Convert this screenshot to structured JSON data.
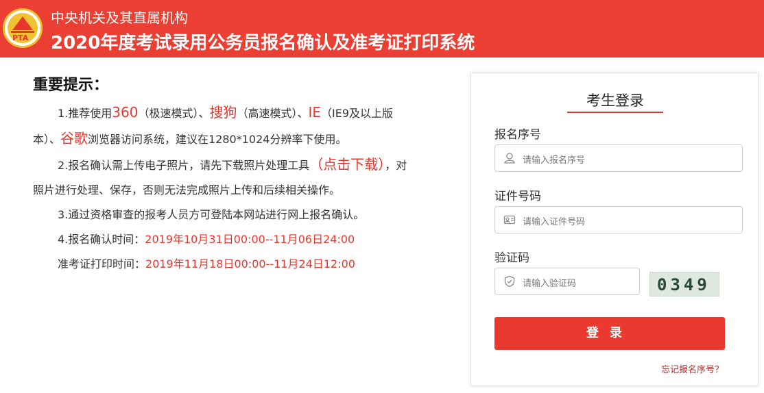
{
  "header": {
    "logo_text": "PTA",
    "subtitle": "中央机关及其直属机构",
    "title": "2020年度考试录用公务员报名确认及准考证打印系统",
    "bg_color": "#ec3f33"
  },
  "notice": {
    "title": "重要提示：",
    "items": [
      {
        "prefix": "1.推荐使用",
        "b1": "360",
        "t1": "（极速模式）、",
        "b2": "搜狗",
        "t2": "（高速模式）、",
        "b3": "IE",
        "t3": "（IE9及以上版本）、",
        "b4": "谷歌",
        "t4": "浏览器访问系统，建议在1280*1024分辨率下使用。"
      },
      {
        "prefix": "2.报名确认需上传电子照片，请先下载照片处理工具",
        "link": "（点击下载）",
        "suffix": "，对照片进行处理、保存，否则无法完成照片上传和后续相关操作。"
      },
      {
        "text": "3.通过资格审查的报考人员方可登陆本网站进行网上报名确认。"
      },
      {
        "label": "4.报名确认时间：",
        "value": "2019年10月31日00:00--11月06日24:00"
      },
      {
        "label": "准考证打印时间：",
        "value": "2019年11月18日00:00--11月24日12:00"
      }
    ]
  },
  "login": {
    "title": "考生登录",
    "reg_label": "报名序号",
    "reg_placeholder": "请输入报名序号",
    "id_label": "证件号码",
    "id_placeholder": "请输入证件号码",
    "captcha_label": "验证码",
    "captcha_placeholder": "请输入验证码",
    "captcha_text": "0349",
    "submit_label": "登录",
    "forgot_link": "忘记报名序号？",
    "accent_color": "#e8362d"
  }
}
